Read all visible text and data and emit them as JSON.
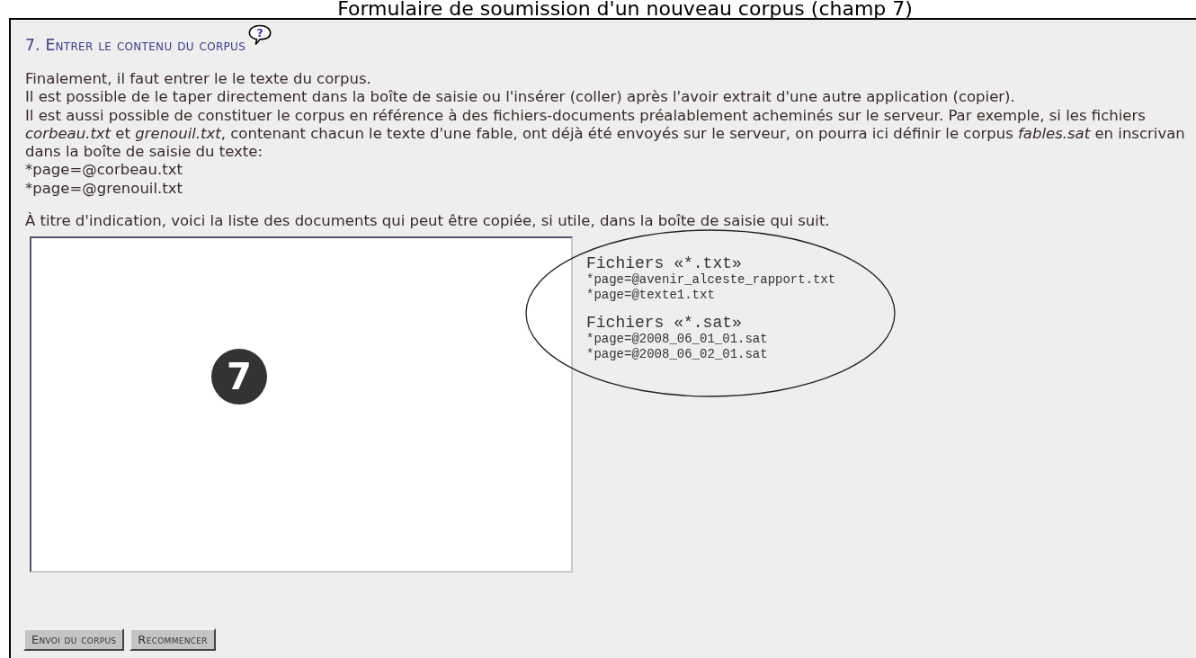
{
  "page_title": "Formulaire de soumission d'un nouveau corpus (champ 7)",
  "section": {
    "heading": "7. Entrer le contenu du corpus",
    "help_icon": "?"
  },
  "paragraphs": [
    "Finalement, il faut entrer le le texte du corpus.",
    "Il est possible de le taper directement dans la boîte de saisie ou l'insérer (coller) après l'avoir extrait d'une autre application (copier).",
    "Il est aussi possible de constituer le corpus en référence à des fichiers-documents préalablement acheminés sur le serveur. Par exemple, si les fichiers",
    "*corbeau.txt* et *grenouil.txt*, contenant chacun le texte d'une fable, ont déjà été envoyés sur le serveur, on pourra ici définir le corpus *fables.sat* en inscrivan",
    "dans la boîte de saisie du texte:",
    "*page=@corbeau.txt",
    "*page=@grenouil.txt"
  ],
  "hint": "À titre d'indication, voici la liste des documents qui peut être copiée, si utile, dans la boîte de saisie qui suit.",
  "step_badge": "7",
  "file_groups": [
    {
      "title": "Fichiers «*.txt»",
      "files": [
        "*page=@avenir_alceste_rapport.txt",
        "*page=@texte1.txt"
      ]
    },
    {
      "title": "Fichiers «*.sat»",
      "files": [
        "*page=@2008_06_01_01.sat",
        "*page=@2008_06_02_01.sat"
      ]
    }
  ],
  "buttons": [
    "Envoi du corpus",
    "Recommencer"
  ]
}
